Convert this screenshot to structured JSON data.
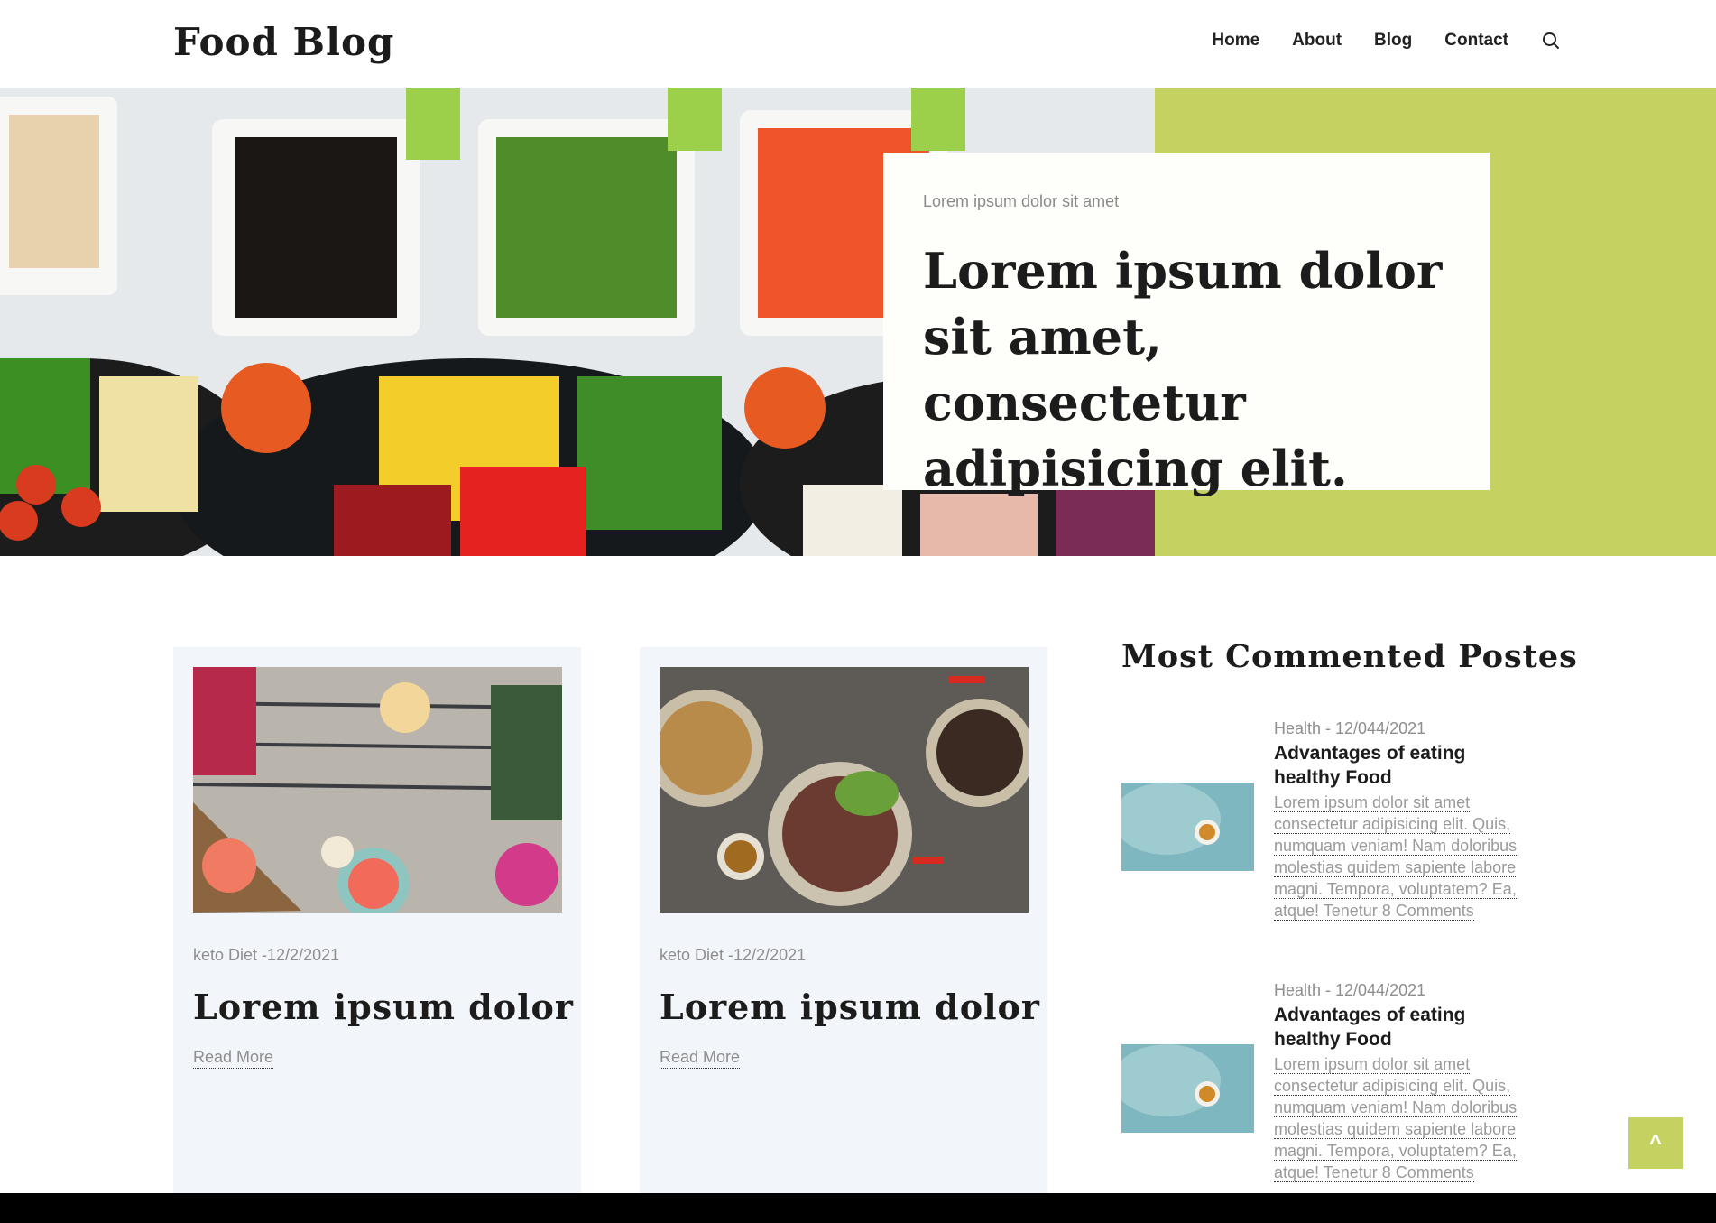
{
  "header": {
    "logo": "Food Blog",
    "nav": [
      "Home",
      "About",
      "Blog",
      "Contact"
    ],
    "search_icon": "search-icon"
  },
  "hero": {
    "kicker": "Lorem ipsum dolor sit amet",
    "title": "Lorem ipsum dolor sit amet, consectetur adipisicing elit.",
    "accent_color": "#c5d160"
  },
  "posts": [
    {
      "meta": "keto Diet -12/2/2021",
      "title": "Lorem ipsum dolor",
      "link": "Read More"
    },
    {
      "meta": "keto Diet -12/2/2021",
      "title": "Lorem ipsum dolor",
      "link": "Read More"
    }
  ],
  "sidebar": {
    "title": "Most Commented Postes",
    "items": [
      {
        "meta": "Health - 12/044/2021",
        "title": "Advantages of eating healthy Food",
        "text": "Lorem ipsum dolor sit amet consectetur adipisicing elit. Quis, numquam veniam! Nam doloribus molestias quidem sapiente labore magni. Tempora, voluptatem? Ea, atque! Tenetur 8 Comments"
      },
      {
        "meta": "Health - 12/044/2021",
        "title": "Advantages of eating healthy Food",
        "text": "Lorem ipsum dolor sit amet consectetur adipisicing elit. Quis, numquam veniam! Nam doloribus molestias quidem sapiente labore magni. Tempora, voluptatem? Ea, atque! Tenetur 8 Comments"
      }
    ]
  },
  "back_to_top": "^"
}
